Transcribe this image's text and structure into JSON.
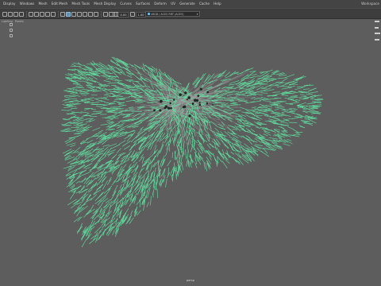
{
  "menubar": {
    "items": [
      "Display",
      "Windows",
      "Mesh",
      "Edit Mesh",
      "Mesh Tools",
      "Mesh Display",
      "Curves",
      "Surfaces",
      "Deform",
      "UV",
      "Generate",
      "Cache",
      "Help"
    ],
    "workspace": "Workspace"
  },
  "toolbar": {
    "field_1": "0.00",
    "field_2": "1.00",
    "camera_dropdown": "sRGB / ACES RRT (ACES)"
  },
  "panel_menu": {
    "items": [
      "Lighting",
      "Panels"
    ]
  },
  "viewport": {
    "camera_label": "persp",
    "background_color": "#5d5d5d",
    "curve_color": "#5fe0a0",
    "shaft_color": "#9a9a9a"
  }
}
